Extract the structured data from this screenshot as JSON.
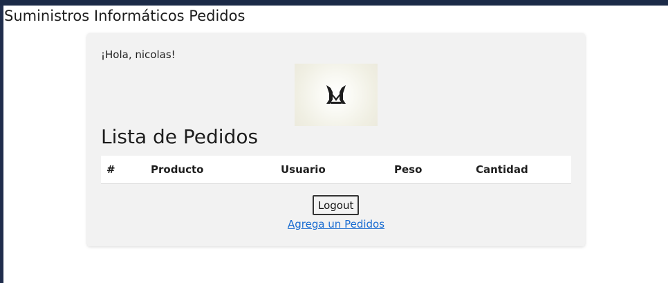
{
  "header": {
    "title": "Suministros Informáticos Pedidos"
  },
  "main": {
    "greeting": "¡Hola, nicolas!",
    "logo_icon": "winged-dg-logo-icon",
    "section_title": "Lista de Pedidos",
    "table": {
      "columns": [
        "#",
        "Producto",
        "Usuario",
        "Peso",
        "Cantidad"
      ],
      "rows": []
    },
    "logout_label": "Logout",
    "add_link_label": "Agrega un Pedidos"
  },
  "colors": {
    "top_bar": "#1b2a47",
    "card_bg": "#f2f2f2",
    "link": "#1a6cd1"
  }
}
